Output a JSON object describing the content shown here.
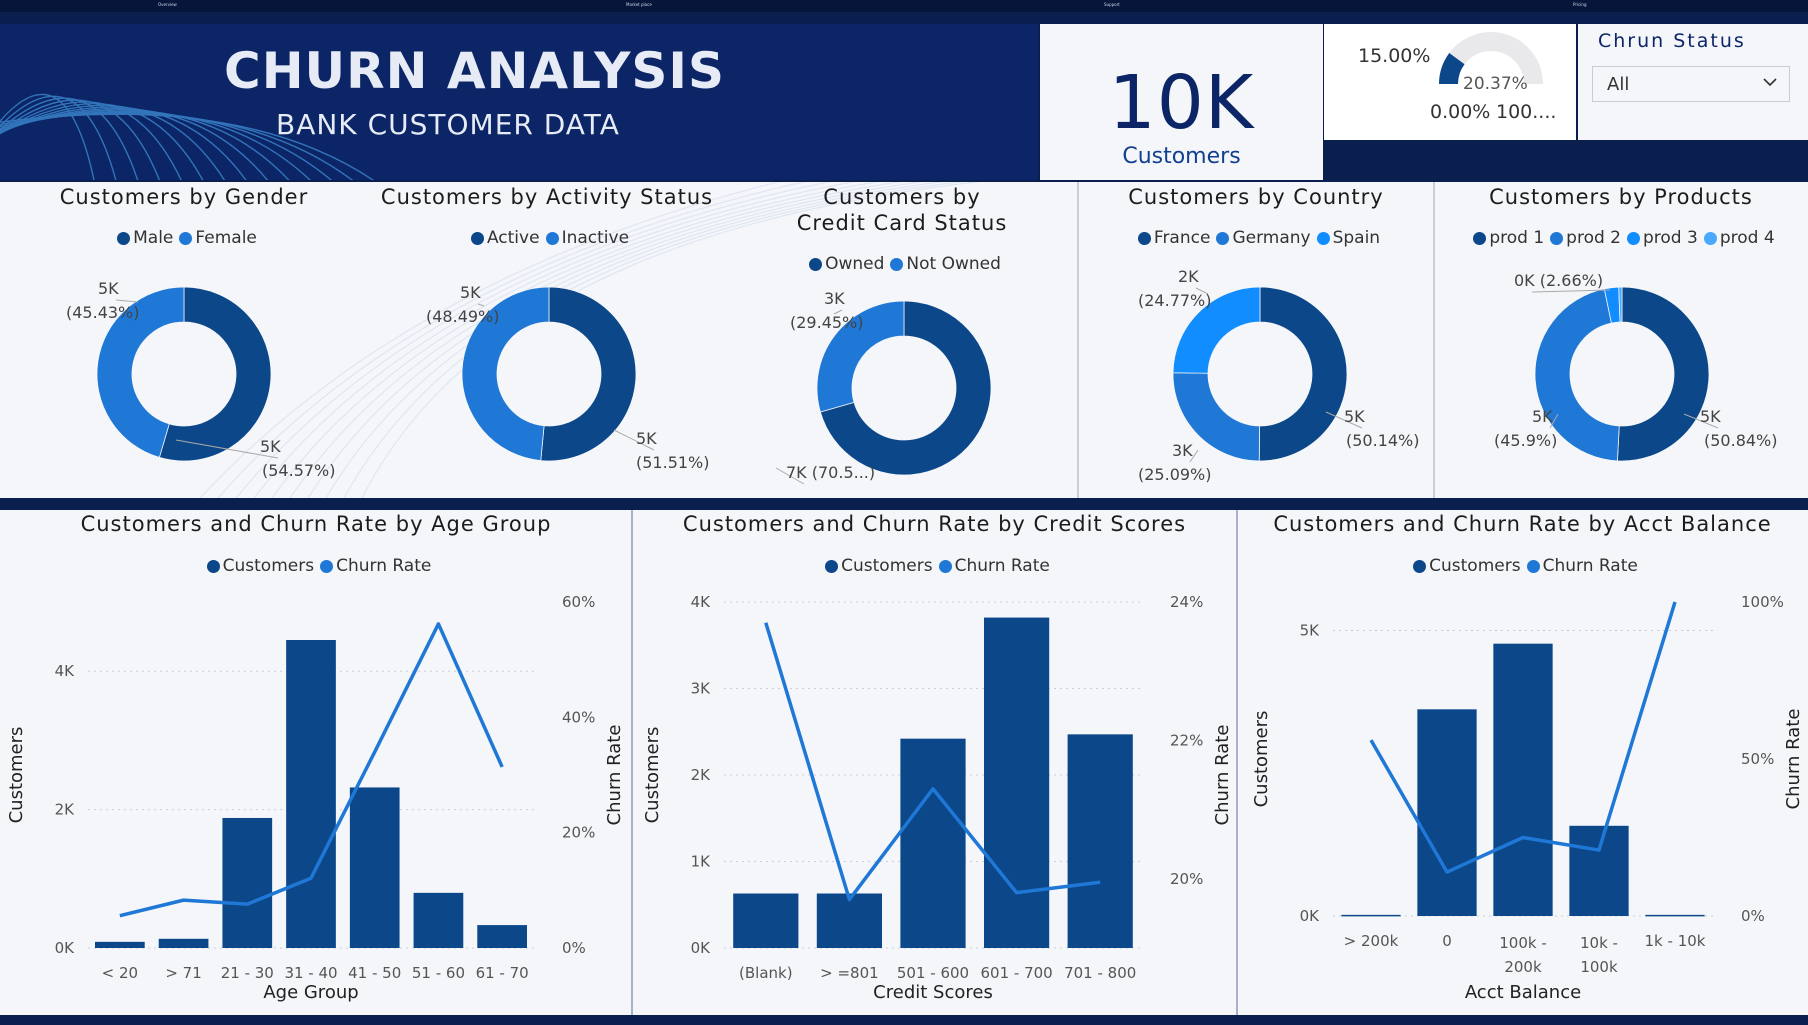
{
  "header": {
    "title": "CHURN ANALYSIS",
    "subtitle": "BANK CUSTOMER  DATA",
    "top_tabs": [
      "Overview",
      "Market place",
      "Support",
      "Pricing"
    ]
  },
  "kpi": {
    "value": "10K",
    "label": "Customers"
  },
  "gauge": {
    "target_label": "15.00%",
    "value_label": "20.37%",
    "min_label": "0.00%",
    "max_label": "100....",
    "value": 20.37,
    "min": 0,
    "max": 100
  },
  "slicer": {
    "title": "Chrun Status",
    "selected": "All"
  },
  "colors": {
    "dark": "#0b4789",
    "mid": "#1f77d6",
    "light": "#118dff",
    "lighter": "#4aa8ff",
    "navy": "#0b2566"
  },
  "chart_data": [
    {
      "id": "gender",
      "type": "pie",
      "title": "Customers by Gender",
      "legend": [
        "Male",
        "Female"
      ],
      "slices": [
        {
          "name": "Male",
          "value": 54.57,
          "label_value": "5K",
          "label_pct": "(54.57%)",
          "color": "#0b4789"
        },
        {
          "name": "Female",
          "value": 45.43,
          "label_value": "5K",
          "label_pct": "(45.43%)",
          "color": "#1f77d6"
        }
      ]
    },
    {
      "id": "activity",
      "type": "pie",
      "title": "Customers by Activity Status",
      "legend": [
        "Active",
        "Inactive"
      ],
      "slices": [
        {
          "name": "Active",
          "value": 51.51,
          "label_value": "5K",
          "label_pct": "(51.51%)",
          "color": "#0b4789"
        },
        {
          "name": "Inactive",
          "value": 48.49,
          "label_value": "5K",
          "label_pct": "(48.49%)",
          "color": "#1f77d6"
        }
      ]
    },
    {
      "id": "creditcard",
      "type": "pie",
      "title": "Customers by Credit Card Status",
      "legend": [
        "Owned",
        "Not Owned"
      ],
      "slices": [
        {
          "name": "Owned",
          "value": 70.55,
          "label_value": "7K (70.5...)",
          "label_pct": "",
          "color": "#0b4789"
        },
        {
          "name": "Not Owned",
          "value": 29.45,
          "label_value": "3K",
          "label_pct": "(29.45%)",
          "color": "#1f77d6"
        }
      ]
    },
    {
      "id": "country",
      "type": "pie",
      "title": "Customers by Country",
      "legend": [
        "France",
        "Germany",
        "Spain"
      ],
      "slices": [
        {
          "name": "France",
          "value": 50.14,
          "label_value": "5K",
          "label_pct": "(50.14%)",
          "color": "#0b4789"
        },
        {
          "name": "Germany",
          "value": 25.09,
          "label_value": "3K",
          "label_pct": "(25.09%)",
          "color": "#1f77d6"
        },
        {
          "name": "Spain",
          "value": 24.77,
          "label_value": "2K",
          "label_pct": "(24.77%)",
          "color": "#118dff"
        }
      ]
    },
    {
      "id": "products",
      "type": "pie",
      "title": "Customers by Products",
      "legend": [
        "prod 1",
        "prod 2",
        "prod 3",
        "prod 4"
      ],
      "slices": [
        {
          "name": "prod 1",
          "value": 50.84,
          "label_value": "5K",
          "label_pct": "(50.84%)",
          "color": "#0b4789"
        },
        {
          "name": "prod 2",
          "value": 45.9,
          "label_value": "5K",
          "label_pct": "(45.9%)",
          "color": "#1f77d6"
        },
        {
          "name": "prod 3",
          "value": 2.66,
          "label_value": "0K (2.66%)",
          "label_pct": "",
          "color": "#118dff"
        },
        {
          "name": "prod 4",
          "value": 0.6,
          "label_value": "",
          "label_pct": "",
          "color": "#4aa8ff"
        }
      ]
    },
    {
      "id": "age",
      "type": "bar",
      "title": "Customers and Churn Rate by Age Group",
      "legend": [
        "Customers",
        "Churn Rate"
      ],
      "xlabel": "Age Group",
      "ylabel": "Customers",
      "y2label": "Churn Rate",
      "categories": [
        "< 20",
        "> 71",
        "21 - 30",
        "31 - 40",
        "41 - 50",
        "51 - 60",
        "61 - 70"
      ],
      "series": [
        {
          "name": "Customers",
          "type": "bar",
          "values": [
            89,
            133,
            1879,
            4451,
            2320,
            797,
            331
          ]
        },
        {
          "name": "Churn Rate",
          "type": "line",
          "values": [
            5.6,
            8.3,
            7.6,
            12.1,
            34.0,
            56.2,
            31.4
          ]
        }
      ],
      "ylim": [
        0,
        5000
      ],
      "yticks": [
        0,
        2000,
        4000
      ],
      "ytick_labels": [
        "0K",
        "2K",
        "4K"
      ],
      "y2lim": [
        0,
        60
      ],
      "y2ticks": [
        0,
        20,
        40,
        60
      ],
      "y2tick_labels": [
        "0%",
        "20%",
        "40%",
        "60%"
      ]
    },
    {
      "id": "credit",
      "type": "bar",
      "title": "Customers and Churn Rate by Credit Scores",
      "legend": [
        "Customers",
        "Churn Rate"
      ],
      "xlabel": "Credit Scores",
      "ylabel": "Customers",
      "y2label": "Churn Rate",
      "categories": [
        "(Blank)",
        "> =801",
        "501 - 600",
        "601 - 700",
        "701 - 800"
      ],
      "series": [
        {
          "name": "Customers",
          "type": "bar",
          "values": [
            630,
            630,
            2420,
            3820,
            2470
          ]
        },
        {
          "name": "Churn Rate",
          "type": "line",
          "values": [
            23.7,
            19.7,
            21.3,
            19.8,
            19.95
          ]
        }
      ],
      "ylim": [
        0,
        4000
      ],
      "yticks": [
        0,
        1000,
        2000,
        3000,
        4000
      ],
      "ytick_labels": [
        "0K",
        "1K",
        "2K",
        "3K",
        "4K"
      ],
      "y2lim": [
        19,
        24
      ],
      "y2ticks": [
        20,
        22,
        24
      ],
      "y2tick_labels": [
        "20%",
        "22%",
        "24%"
      ]
    },
    {
      "id": "balance",
      "type": "bar",
      "title": "Customers and Churn Rate by Acct Balance",
      "legend": [
        "Customers",
        "Churn Rate"
      ],
      "xlabel": "Acct Balance",
      "ylabel": "Customers",
      "y2label": "Churn Rate",
      "categories": [
        "> 200k",
        "0",
        "100k - 200k",
        "10k - 100k",
        "1k - 10k"
      ],
      "series": [
        {
          "name": "Customers",
          "type": "bar",
          "values": [
            20,
            3620,
            4770,
            1580,
            20
          ]
        },
        {
          "name": "Churn Rate",
          "type": "line",
          "values": [
            56,
            14,
            25,
            21,
            100
          ]
        }
      ],
      "ylim": [
        0,
        5500
      ],
      "yticks": [
        0,
        5000
      ],
      "ytick_labels": [
        "0K",
        "5K"
      ],
      "y2lim": [
        0,
        100
      ],
      "y2ticks": [
        0,
        50,
        100
      ],
      "y2tick_labels": [
        "0%",
        "50%",
        "100%"
      ]
    }
  ]
}
